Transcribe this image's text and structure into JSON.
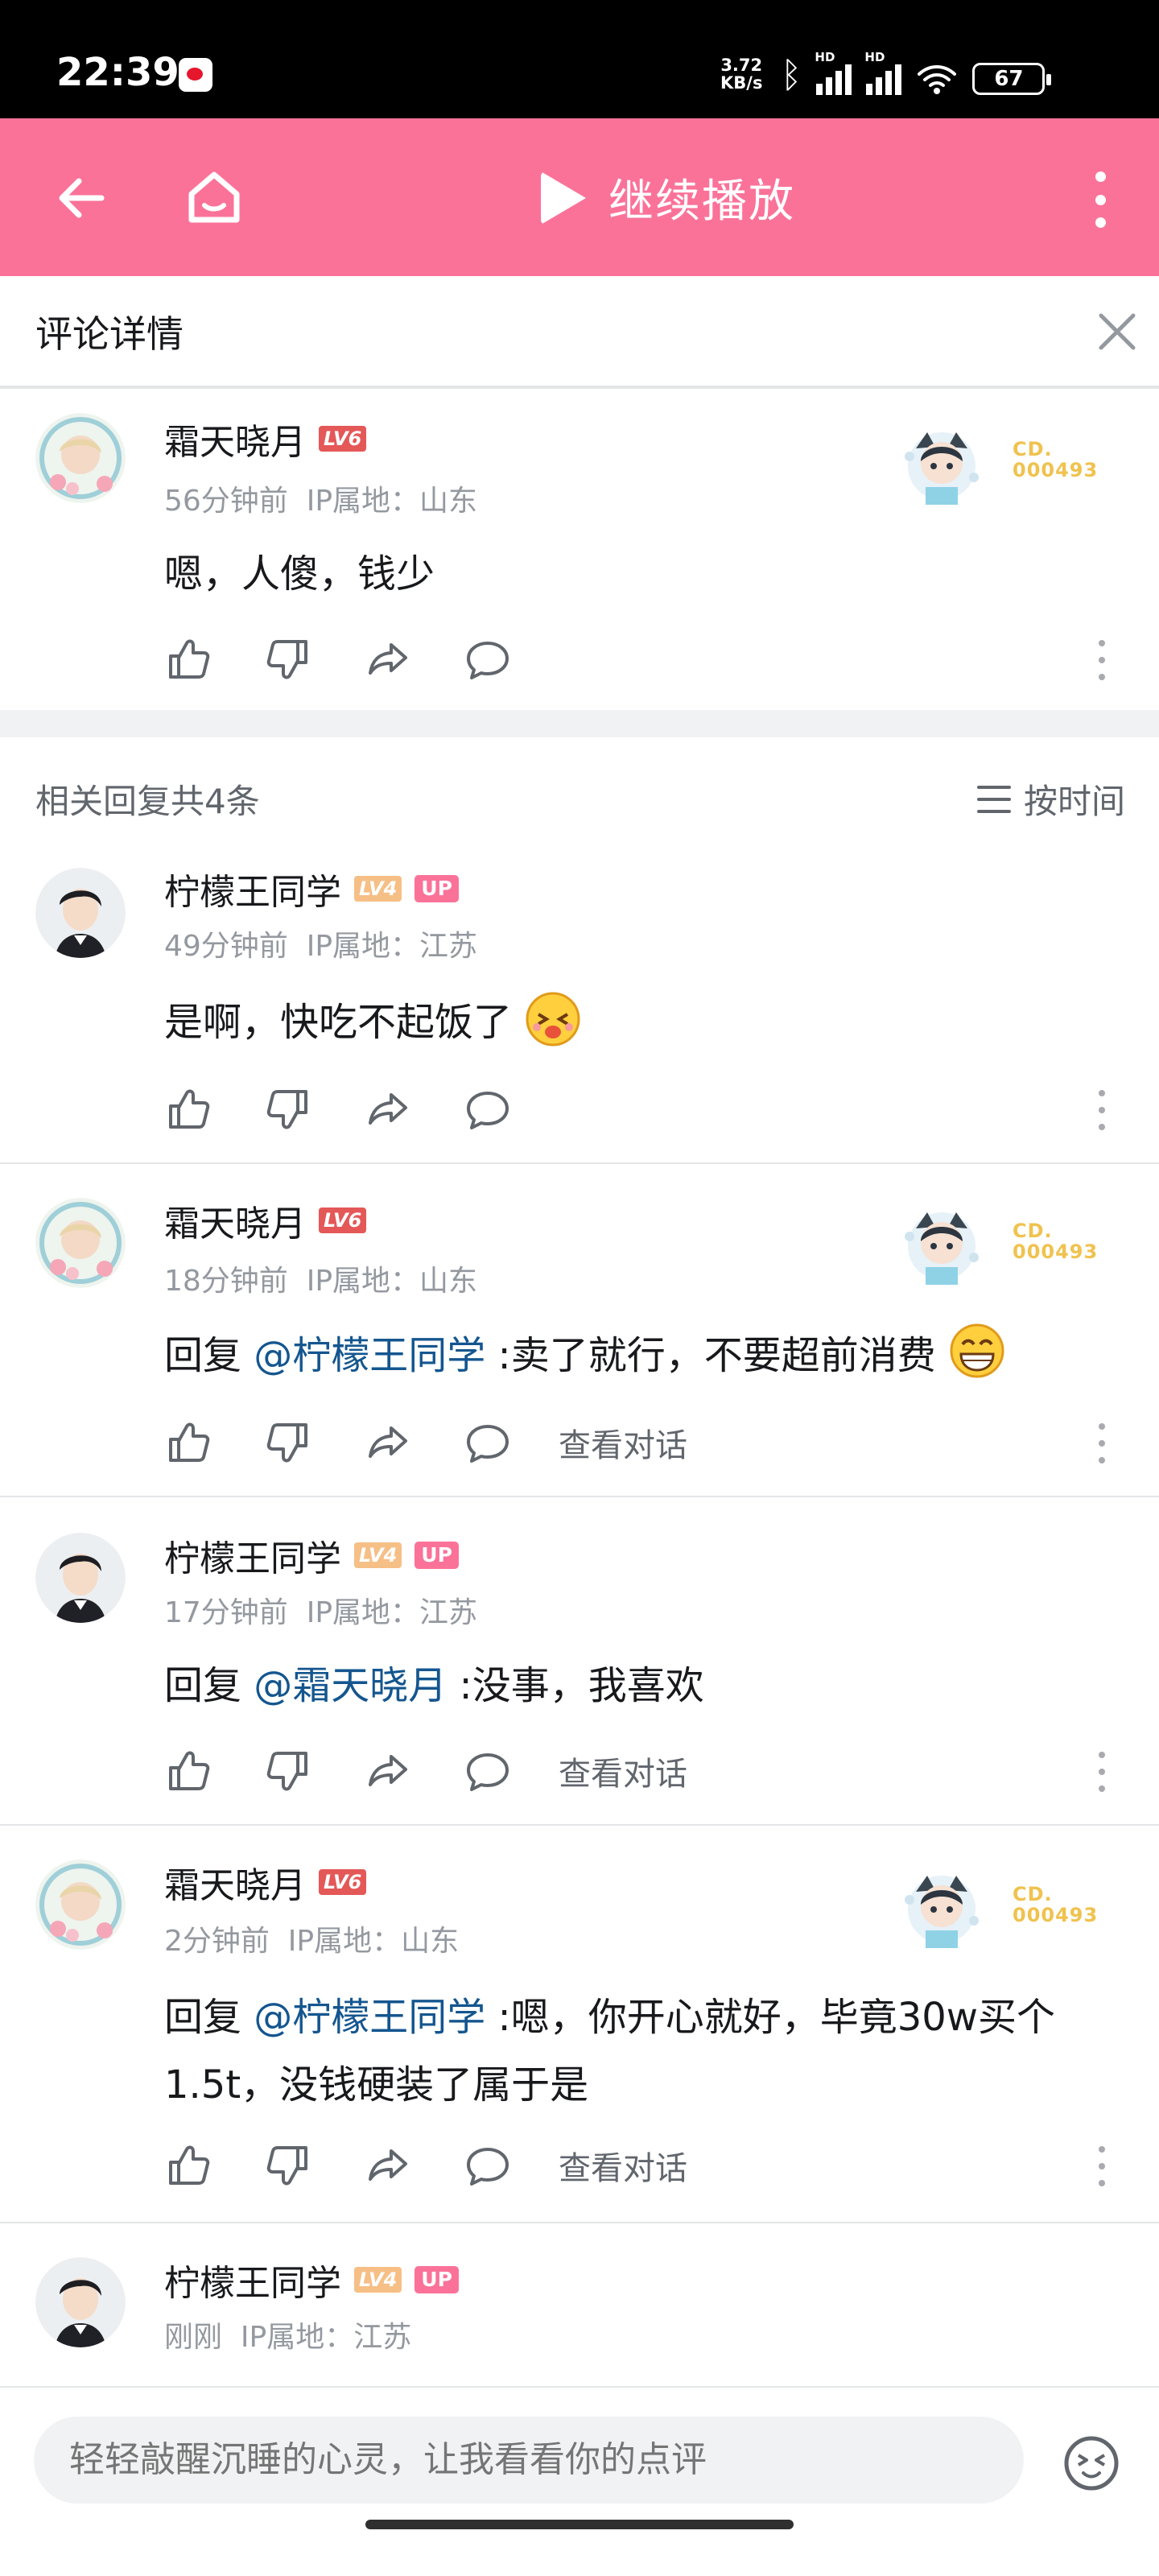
{
  "status_bar": {
    "time": "22:39",
    "speed_value": "3.72",
    "speed_unit": "KB/s",
    "signal_label_1": "HD",
    "signal_label_2": "HD",
    "wifi_sub": "6",
    "battery": "67"
  },
  "toolbar": {
    "play_label": "继续播放",
    "accent_color": "#fb7299"
  },
  "detail_header": {
    "title": "评论详情"
  },
  "main_comment": {
    "username": "霜天晓月",
    "level": "LV6",
    "time": "56分钟前",
    "ip": "IP属地：山东",
    "content": "嗯，人傻，钱少",
    "badge_line1": "CD.",
    "badge_line2": "000493"
  },
  "replies_header": {
    "count_text": "相关回复共4条",
    "sort_label": "按时间"
  },
  "replies": [
    {
      "username": "柠檬王同学",
      "level": "LV4",
      "up": "UP",
      "time": "49分钟前",
      "ip": "IP属地：江苏",
      "content": "是啊，快吃不起饭了"
    },
    {
      "username": "霜天晓月",
      "level": "LV6",
      "time": "18分钟前",
      "ip": "IP属地：山东",
      "reply_prefix": "回复 ",
      "mention": "@柠檬王同学",
      "content": " :卖了就行，不要超前消费",
      "view_label": "查看对话",
      "badge_line1": "CD.",
      "badge_line2": "000493"
    },
    {
      "username": "柠檬王同学",
      "level": "LV4",
      "up": "UP",
      "time": "17分钟前",
      "ip": "IP属地：江苏",
      "reply_prefix": "回复 ",
      "mention": "@霜天晓月",
      "content": " :没事，我喜欢",
      "view_label": "查看对话"
    },
    {
      "username": "霜天晓月",
      "level": "LV6",
      "time": "2分钟前",
      "ip": "IP属地：山东",
      "reply_prefix": "回复 ",
      "mention": "@柠檬王同学",
      "content": " :嗯，你开心就好，毕竟30w买个1.5t，没钱硬装了属于是",
      "view_label": "查看对话",
      "badge_line1": "CD.",
      "badge_line2": "000493"
    },
    {
      "username": "柠檬王同学",
      "level": "LV4",
      "up": "UP",
      "time": "刚刚",
      "ip": "IP属地：江苏"
    }
  ],
  "input": {
    "placeholder": "轻轻敲醒沉睡的心灵，让我看看你的点评"
  }
}
